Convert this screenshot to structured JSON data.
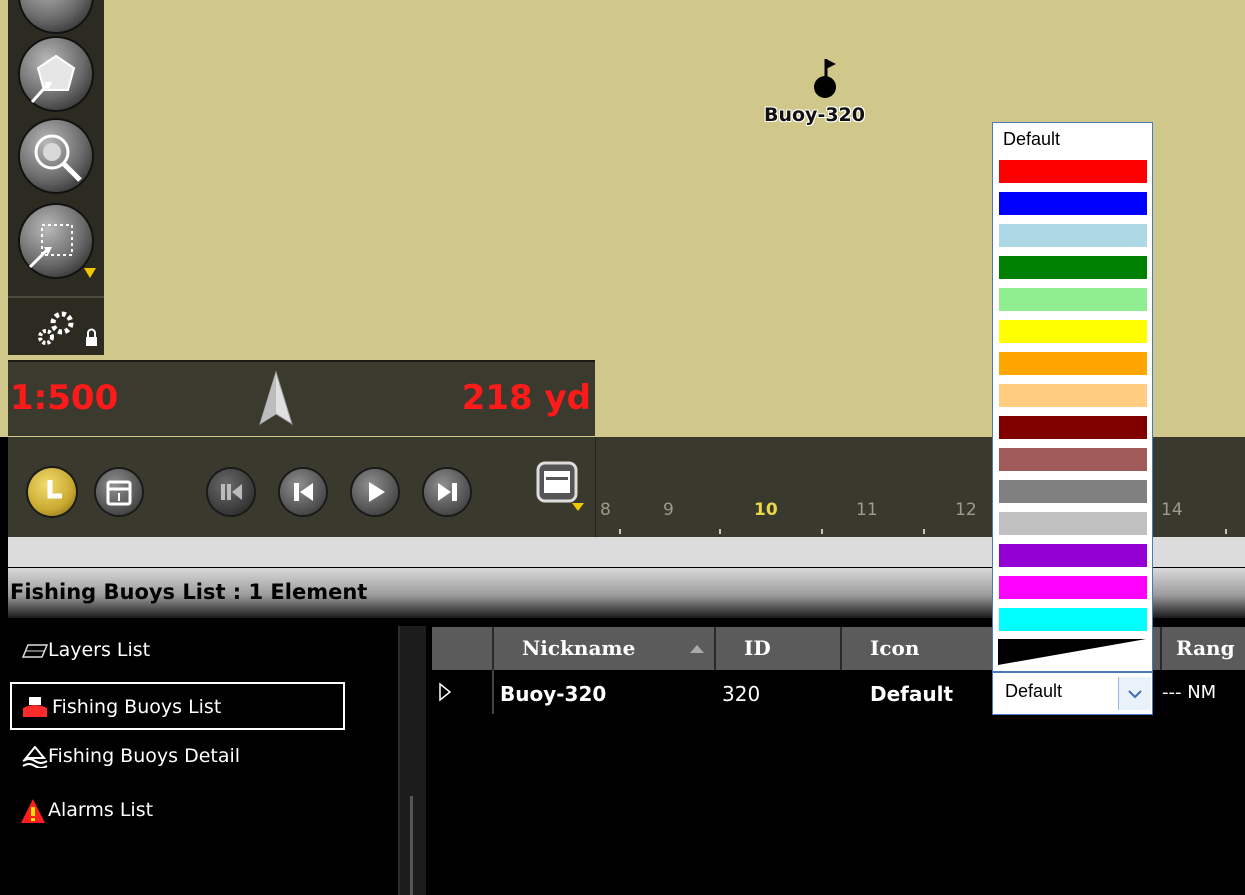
{
  "map": {
    "buoy_label": "Buoy-320",
    "scale": "1:500",
    "distance": "218 yd"
  },
  "toolbar": {
    "tools": [
      "navigation-tool",
      "select-area-tool",
      "zoom-search-tool",
      "rectangle-select-tool"
    ],
    "settings": "settings"
  },
  "timeline": {
    "ticks": [
      "8",
      "9",
      "10",
      "11",
      "12",
      "14"
    ],
    "highlight_tick": "10",
    "highlight_color": "#e8d84a"
  },
  "list": {
    "title": "Fishing Buoys List : 1 Element",
    "nav": [
      "Layers List",
      "Fishing Buoys List",
      "Fishing Buoys Detail",
      "Alarms List"
    ],
    "columns": [
      "Nickname",
      "ID",
      "Icon",
      "Rang"
    ],
    "rows": [
      {
        "nickname": "Buoy-320",
        "id": "320",
        "icon": "Default",
        "color": "Default",
        "range": "--- NM"
      }
    ]
  },
  "dropdown": {
    "first_option": "Default",
    "colors": [
      "#ff0000",
      "#0000ff",
      "#add8e6",
      "#008000",
      "#90ee90",
      "#ffff00",
      "#ffa500",
      "#ffcc80",
      "#800000",
      "#a05a5a",
      "#808080",
      "#c0c0c0",
      "#9400d3",
      "#ff00ff",
      "#00ffff"
    ],
    "selected_value": "Default"
  },
  "colors": {
    "map_bg": "#d0c88b",
    "scale_red": "#ff1a1a",
    "accent": "#4a7ab7"
  }
}
